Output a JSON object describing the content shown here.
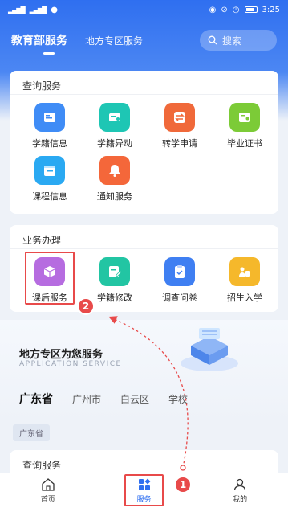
{
  "status": {
    "time": "3:25",
    "left_icons": "signal-icons",
    "right_icons": "system-icons"
  },
  "header": {
    "tab_active": "教育部服务",
    "tab_other": "地方专区服务",
    "search_placeholder": "搜索"
  },
  "query_section": {
    "title": "查询服务",
    "items": [
      {
        "label": "学籍信息",
        "icon": "id-card-icon",
        "color": "#3f8cf6"
      },
      {
        "label": "学籍异动",
        "icon": "exchange-card-icon",
        "color": "#1ec6b4"
      },
      {
        "label": "转学申请",
        "icon": "transfer-icon",
        "color": "#f0693a"
      },
      {
        "label": "毕业证书",
        "icon": "certificate-icon",
        "color": "#7ccb37"
      },
      {
        "label": "课程信息",
        "icon": "calendar-icon",
        "color": "#2aa9f2"
      },
      {
        "label": "通知服务",
        "icon": "bell-icon",
        "color": "#f4673a"
      }
    ]
  },
  "business_section": {
    "title": "业务办理",
    "items": [
      {
        "label": "课后服务",
        "icon": "box-icon",
        "color": "#b66ce0"
      },
      {
        "label": "学籍修改",
        "icon": "edit-icon",
        "color": "#22c5a3"
      },
      {
        "label": "调查问卷",
        "icon": "clipboard-check-icon",
        "color": "#3f7ff2"
      },
      {
        "label": "招生入学",
        "icon": "enrollment-icon",
        "color": "#f5b82b"
      }
    ]
  },
  "app_service": {
    "title": "地方专区为您服务",
    "subtitle": "APPLICATION SERVICE"
  },
  "region_tabs": [
    "广东省",
    "广州市",
    "白云区",
    "学校"
  ],
  "province_chip": "广东省",
  "lower_card_title": "查询服务",
  "tabbar": [
    {
      "label": "首页",
      "icon": "home-icon"
    },
    {
      "label": "服务",
      "icon": "grid-diamond-icon"
    },
    {
      "label": "我的",
      "icon": "user-icon"
    }
  ],
  "steps": [
    "1",
    "2"
  ],
  "colors": {
    "primary": "#2f6ff0",
    "highlight": "#e84a4a"
  }
}
